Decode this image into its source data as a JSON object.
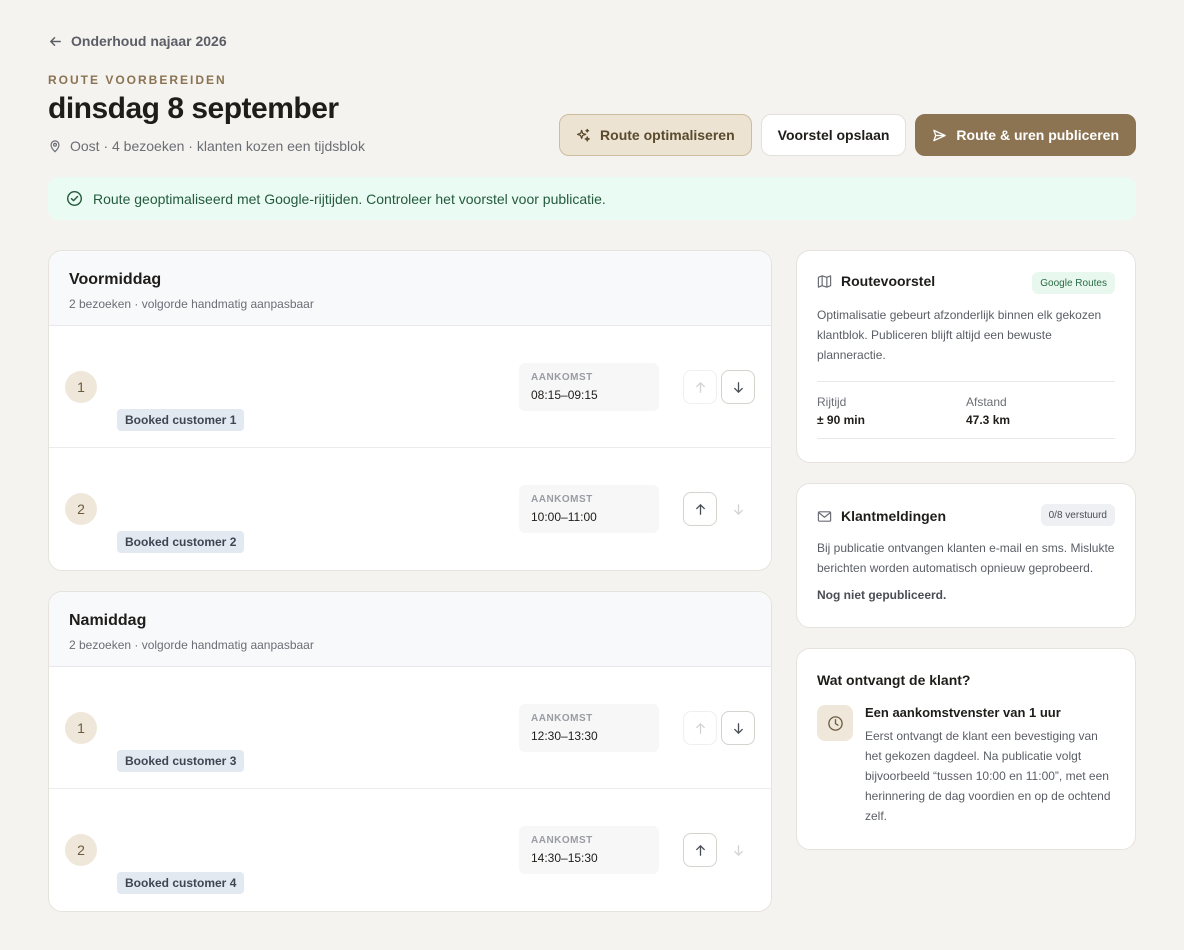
{
  "header": {
    "back_label": "Onderhoud najaar 2026",
    "eyebrow": "ROUTE VOORBEREIDEN",
    "title": "dinsdag 8 september",
    "meta": "Oost · 4 bezoeken · klanten kozen een tijdsblok"
  },
  "actions": {
    "optimize": "Route optimaliseren",
    "save": "Voorstel opslaan",
    "publish": "Route & uren publiceren"
  },
  "banner": "Route geoptimaliseerd met Google-rijtijden. Controleer het voorstel voor publicatie.",
  "blocks": [
    {
      "title": "Voormiddag",
      "subtitle": "2 bezoeken · volgorde handmatig aanpasbaar",
      "visits": [
        {
          "num": "1",
          "customer": "Booked customer 1",
          "arrival_label": "AANKOMST",
          "arrival": "08:15–09:15"
        },
        {
          "num": "2",
          "customer": "Booked customer 2",
          "arrival_label": "AANKOMST",
          "arrival": "10:00–11:00"
        }
      ]
    },
    {
      "title": "Namiddag",
      "subtitle": "2 bezoeken · volgorde handmatig aanpasbaar",
      "visits": [
        {
          "num": "1",
          "customer": "Booked customer 3",
          "arrival_label": "AANKOMST",
          "arrival": "12:30–13:30"
        },
        {
          "num": "2",
          "customer": "Booked customer 4",
          "arrival_label": "AANKOMST",
          "arrival": "14:30–15:30"
        }
      ]
    }
  ],
  "route_card": {
    "title": "Routevoorstel",
    "badge": "Google Routes",
    "description": "Optimalisatie gebeurt afzonderlijk binnen elk gekozen klantblok. Publiceren blijft altijd een bewuste planneractie.",
    "drive_label": "Rijtijd",
    "drive_value": "± 90 min",
    "distance_label": "Afstand",
    "distance_value": "47.3 km"
  },
  "notify_card": {
    "title": "Klantmeldingen",
    "badge": "0/8 verstuurd",
    "description": "Bij publicatie ontvangen klanten e-mail en sms. Mislukte berichten worden automatisch opnieuw geprobeerd.",
    "status": "Nog niet gepubliceerd."
  },
  "customer_card": {
    "title": "Wat ontvangt de klant?",
    "item_title": "Een aankomstvenster van 1 uur",
    "item_text": "Eerst ontvangt de klant een bevestiging van het gekozen dagdeel. Na publicatie volgt bijvoorbeeld “tussen 10:00 en 11:00”, met een herinnering de dag voordien en op de ochtend zelf."
  },
  "colors": {
    "background": "#f5f3ef",
    "accent": "#8c7453",
    "success_bg": "#eafbf3",
    "success_text": "#245a3e"
  }
}
